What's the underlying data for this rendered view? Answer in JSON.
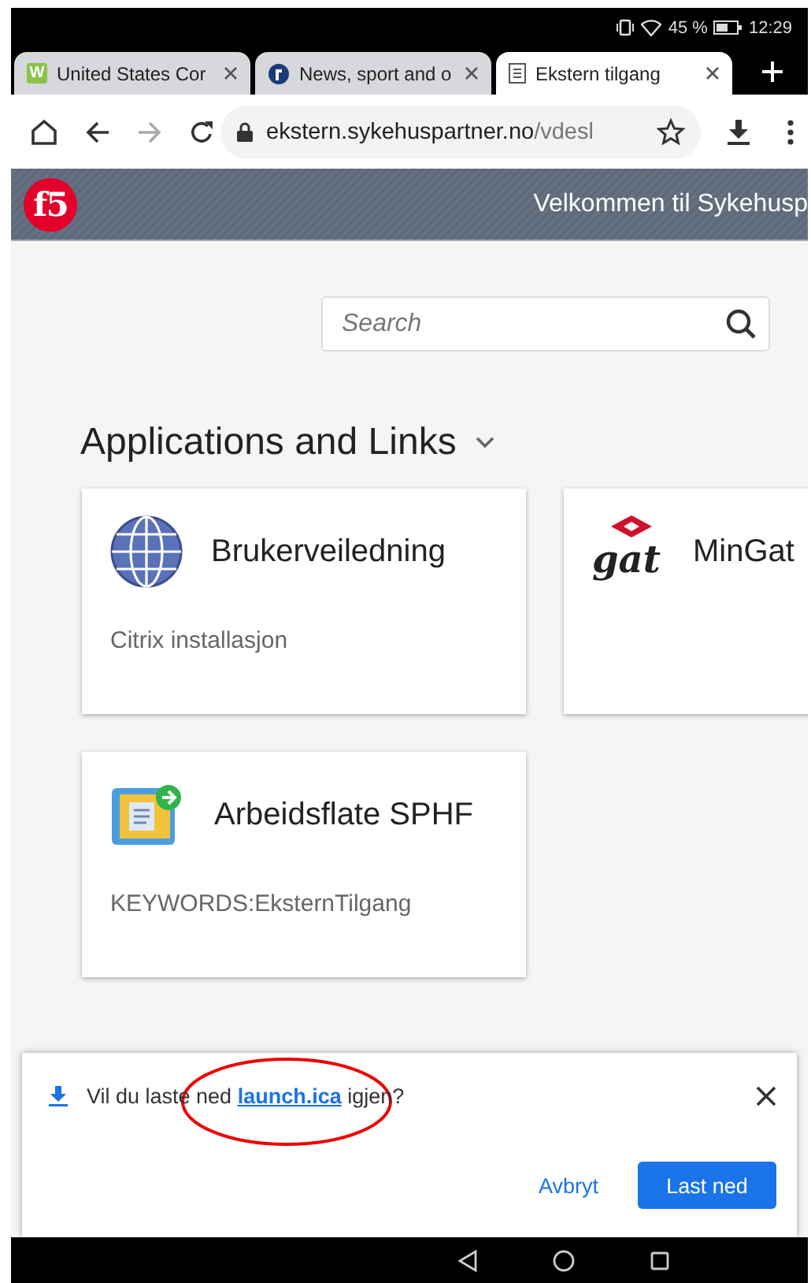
{
  "status_bar": {
    "battery": "45 %",
    "time": "12:29"
  },
  "tabs": [
    {
      "kind": "letter",
      "icon_text": "W",
      "title": "United States Cor",
      "selected": false
    },
    {
      "kind": "round",
      "title": "News, sport and o",
      "selected": false
    },
    {
      "kind": "page",
      "title": "Ekstern tilgang",
      "selected": true
    }
  ],
  "address_bar": {
    "domain": "ekstern.sykehuspartner.no",
    "path": "/vdesl"
  },
  "header": {
    "logo_text": "f5",
    "welcome": "Velkommen til Sykehusp"
  },
  "search": {
    "placeholder": "Search"
  },
  "section": {
    "title": "Applications and Links"
  },
  "apps": [
    {
      "kind": "globe",
      "name": "Brukerveiledning",
      "description": "Citrix installasjon"
    },
    {
      "kind": "gat",
      "logo_text": "gat",
      "name": "MinGat"
    },
    {
      "kind": "desktop",
      "name": "Arbeidsflate SPHF",
      "description": "KEYWORDS:EksternTilgang"
    }
  ],
  "download_prompt": {
    "before": "Vil du laste ned ",
    "file": "launch.ica",
    "after": " igjen?",
    "cancel": "Avbryt",
    "confirm": "Last ned"
  }
}
